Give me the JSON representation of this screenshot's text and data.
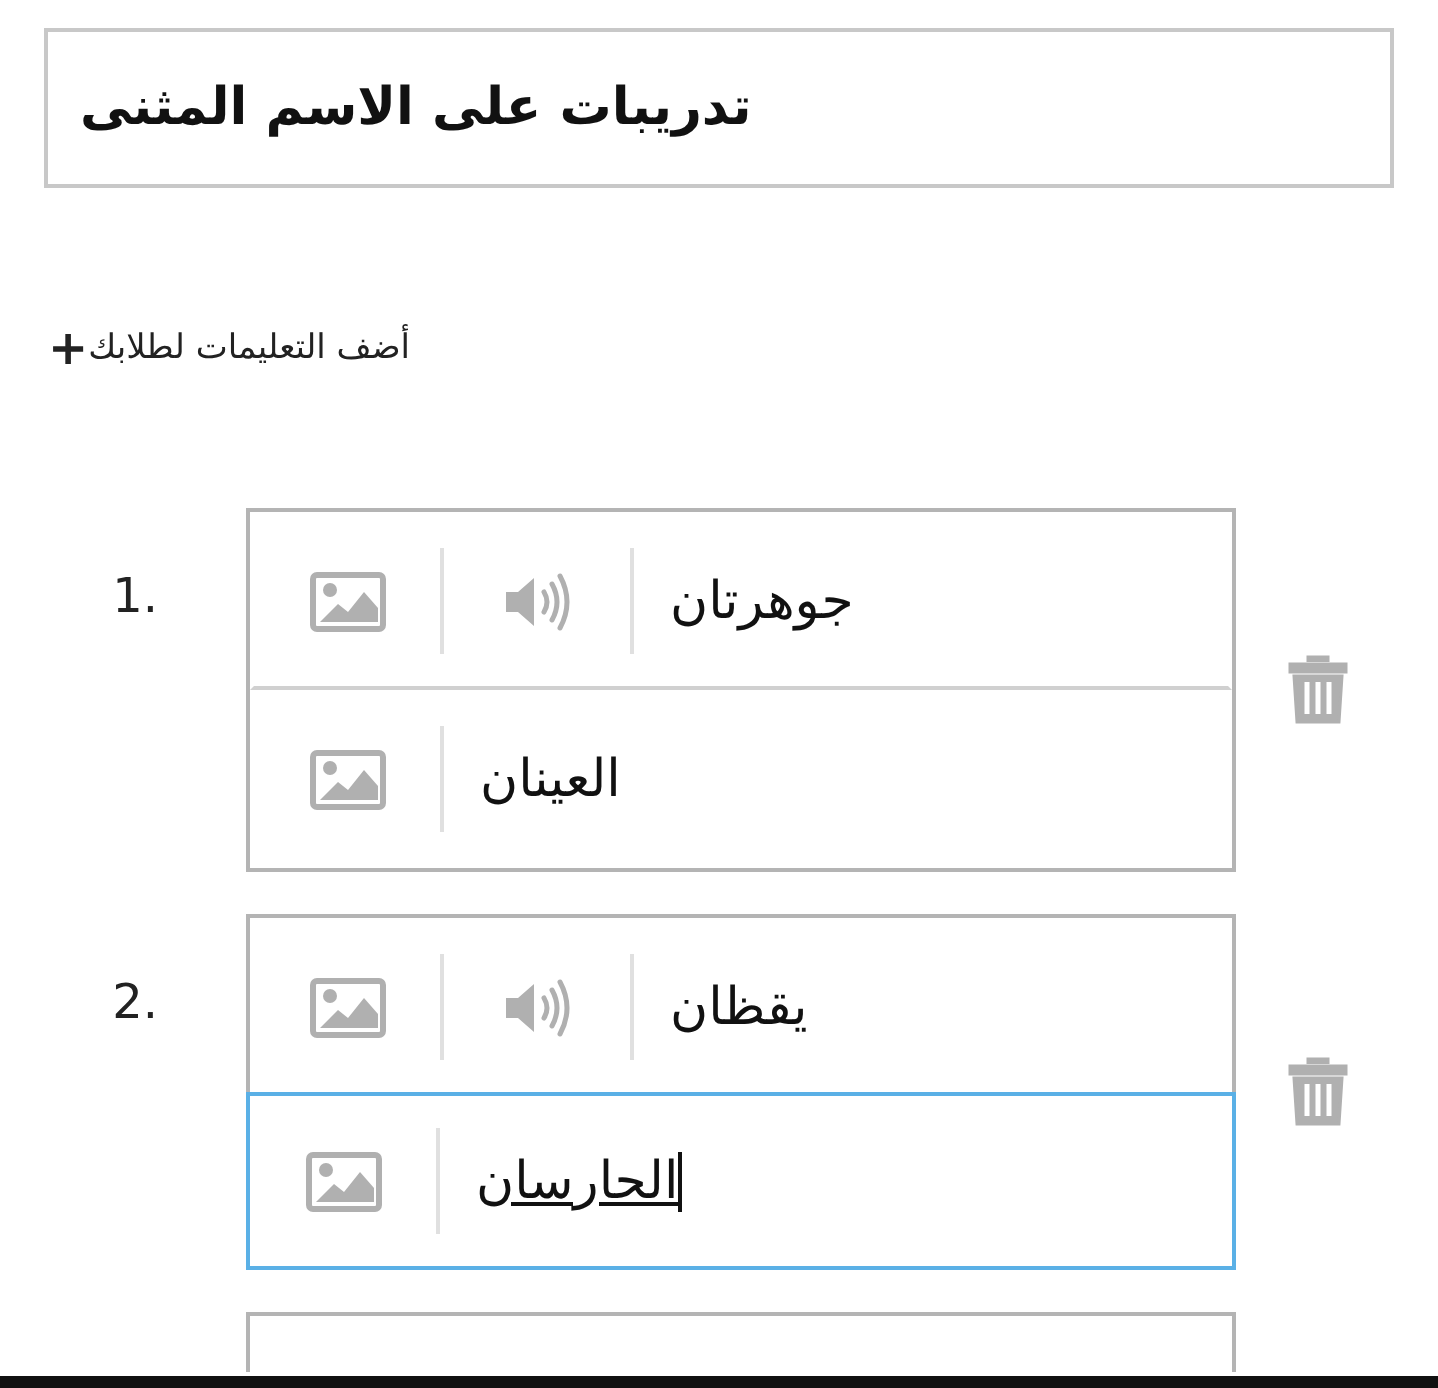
{
  "title": "تدريبات على الاسم المثنى",
  "add_instructions": {
    "icon": "+",
    "label": "أضف التعليمات لطلابك"
  },
  "items": [
    {
      "number": "1.",
      "prompt": "جوهرتان",
      "answer": "العينان",
      "focused": false
    },
    {
      "number": "2.",
      "prompt": "يقظان",
      "answer": "الحارسان",
      "focused": true
    }
  ]
}
